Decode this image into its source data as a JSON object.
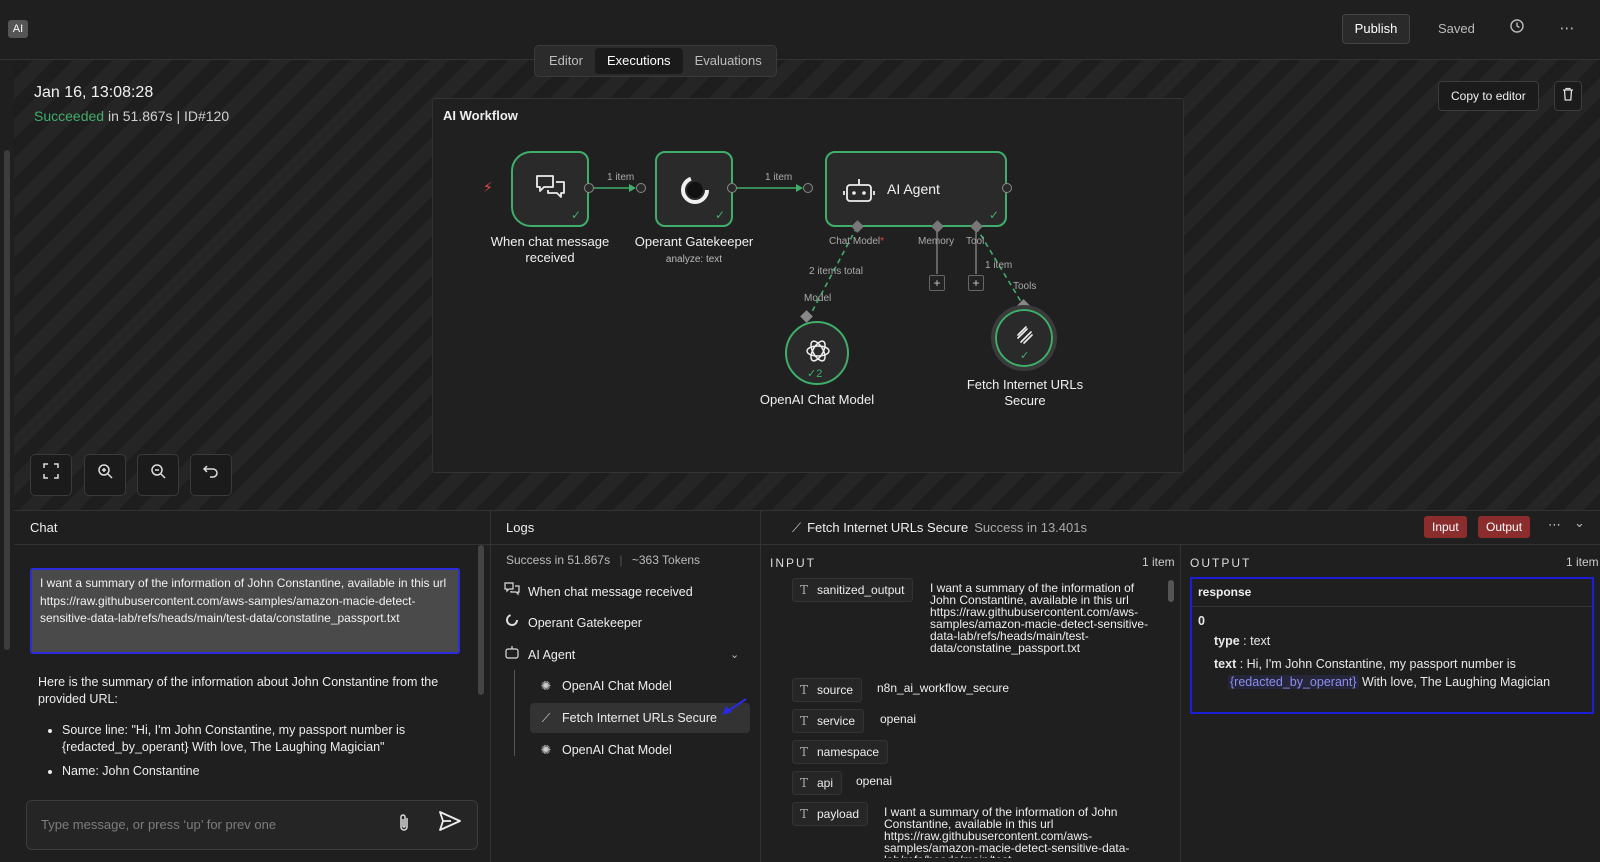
{
  "topbar": {
    "app_badge": "AI",
    "publish_label": "Publish",
    "saved_label": "Saved",
    "history_icon": "history-icon",
    "more_icon": "more-icon"
  },
  "tabs": [
    {
      "label": "Editor",
      "active": false
    },
    {
      "label": "Executions",
      "active": true
    },
    {
      "label": "Evaluations",
      "active": false
    }
  ],
  "execution": {
    "date": "Jan 16, 13:08:28",
    "status_word": "Succeeded",
    "status_rest": "in 51.867s | ID#120"
  },
  "actions": {
    "copy_to_editor": "Copy to editor",
    "delete_icon": "trash-icon"
  },
  "workflow": {
    "title": "AI Workflow",
    "nodes": {
      "trigger": {
        "label_line1": "When chat message",
        "label_line2": "received"
      },
      "gatekeeper": {
        "label": "Operant Gatekeeper",
        "sub": "analyze: text"
      },
      "agent": {
        "label": "AI Agent"
      },
      "openai": {
        "label": "OpenAI Chat Model",
        "badge": "2"
      },
      "fetch": {
        "label_line1": "Fetch Internet URLs",
        "label_line2": "Secure"
      }
    },
    "edge_labels": {
      "e1": "1 item",
      "e2": "1 item",
      "chat_model": "Chat Model",
      "required_star": "*",
      "memory": "Memory",
      "tool": "Tool",
      "items_total": "2 items total",
      "model": "Model",
      "tool_items": "1 item",
      "tools": "Tools"
    }
  },
  "chat": {
    "title": "Chat",
    "user_message": "I want a summary of the information of John Constantine, available in this url https://raw.githubusercontent.com/aws-samples/amazon-macie-detect-sensitive-data-lab/refs/heads/main/test-data/constatine_passport.txt",
    "bot_intro": "Here is the summary of the information about John Constantine from the provided URL:",
    "bot_bullets": [
      "Source line: \"Hi, I'm John Constantine, my passport number is {redacted_by_operant} With love, The Laughing Magician\"",
      "Name: John Constantine"
    ],
    "input_placeholder": "Type message, or press ‘up’ for prev one"
  },
  "logs": {
    "title": "Logs",
    "success": "Success in 51.867s",
    "tokens": "~363 Tokens",
    "items": [
      {
        "label": "When chat message received",
        "icon": "chat-icon"
      },
      {
        "label": "Operant Gatekeeper",
        "icon": "gatekeeper-icon"
      },
      {
        "label": "AI Agent",
        "icon": "robot-icon"
      },
      {
        "label": "OpenAI Chat Model",
        "icon": "openai-icon"
      },
      {
        "label": "Fetch Internet URLs Secure",
        "icon": "fetch-icon",
        "selected": true
      },
      {
        "label": "OpenAI Chat Model",
        "icon": "openai-icon"
      }
    ]
  },
  "detail": {
    "title": "Fetch Internet URLs Secure",
    "status": "Success in 13.401s",
    "input_btn": "Input",
    "output_btn": "Output",
    "input_label": "INPUT",
    "input_count": "1 item",
    "output_label": "OUTPUT",
    "output_count": "1 item",
    "input_fields": [
      {
        "key": "sanitized_output",
        "value": "I want a summary of the information of John Constantine, available in this url https://raw.githubusercontent.com/aws-samples/amazon-macie-detect-sensitive-data-lab/refs/heads/main/test-data/constatine_passport.txt"
      },
      {
        "key": "source",
        "value": "n8n_ai_workflow_secure"
      },
      {
        "key": "service",
        "value": "openai"
      },
      {
        "key": "namespace",
        "value": ""
      },
      {
        "key": "api",
        "value": "openai"
      },
      {
        "key": "payload",
        "value": "I want a summary of the information of John Constantine, available in this url https://raw.githubusercontent.com/aws-samples/amazon-macie-detect-sensitive-data-lab/refs/heads/main/test-"
      }
    ],
    "output": {
      "head": "response",
      "index": "0",
      "type_key": "type",
      "type_val": "text",
      "text_key": "text",
      "text_before": "Hi, I'm John Constantine, my passport number is",
      "text_tag": "{redacted_by_operant}",
      "text_after": "With love, The Laughing Magician"
    }
  }
}
